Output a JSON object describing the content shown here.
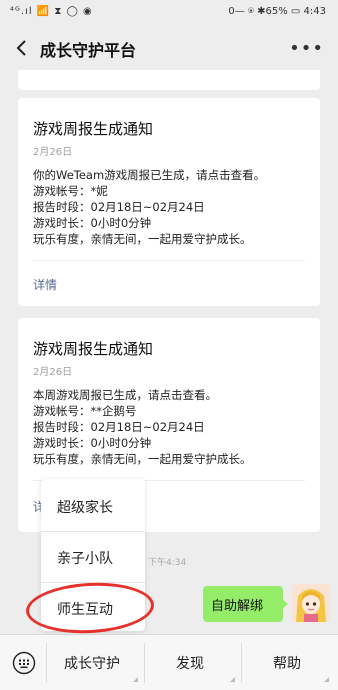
{
  "status_bar": {
    "left_icons": "⁴ᴳ.ıl 📶 ⧗ ◯ ◉",
    "right_text": "0⁠— ⍟ ✱65% ▭ 4:43"
  },
  "nav": {
    "title": "成长守护平台",
    "back_icon": "chevron-left",
    "more_icon": "more-dots"
  },
  "cards": [
    {
      "title": "游戏周报生成通知",
      "date": "2月26日",
      "lines": [
        "你的WeTeam游戏周报已生成，请点击查看。",
        "游戏帐号：*妮",
        "报告时段：02月18日~02月24日",
        "游戏时长：0小时0分钟",
        "玩乐有度，亲情无间，一起用爱守护成长。"
      ],
      "link": "详情"
    },
    {
      "title": "游戏周报生成通知",
      "date": "2月26日",
      "lines": [
        "本周游戏周报已生成，请点击查看。",
        "游戏帐号：**企鹅号",
        "报告时段：02月18日~02月24日",
        "游戏时长：0小时0分钟",
        "玩乐有度，亲情无间，一起用爱守护成长。"
      ],
      "link": "详"
    }
  ],
  "time_label": "下午4:34",
  "popup_menu": {
    "items": [
      "超级家长",
      "亲子小队",
      "师生互动"
    ],
    "highlighted": "师生互动",
    "highlight_color": "#e5322d"
  },
  "chat": {
    "bubble_text": "自助解绑",
    "bubble_color": "#95ec69"
  },
  "bottom_menu": {
    "keyboard_icon": "keyboard-icon",
    "items": [
      "成长守护",
      "发现",
      "帮助"
    ]
  }
}
